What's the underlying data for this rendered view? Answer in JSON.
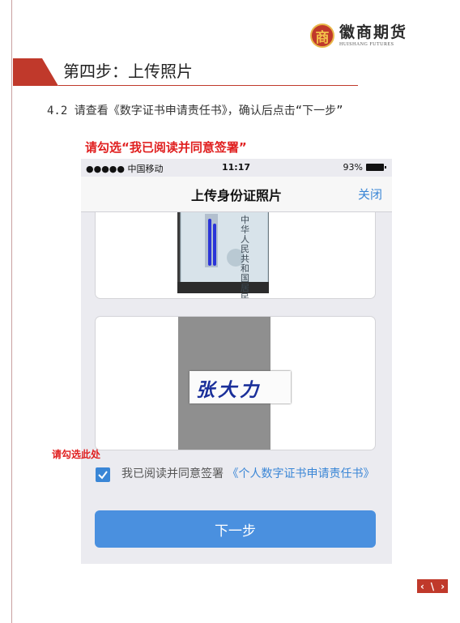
{
  "brand": {
    "emblem_char": "商",
    "name_cn": "徽商期货",
    "name_en": "HUISHANG FUTURES"
  },
  "step": {
    "title": "第四步：上传照片"
  },
  "instruction": {
    "text": "4.2 请查看《数字证书申请责任书》，确认后点击“下一步”"
  },
  "callout": {
    "title": "请勾选“我已阅读并同意签署”",
    "checkbox_hint": "请勾选此处"
  },
  "phone": {
    "status_bar": {
      "signal": "●●●●● 中国移动",
      "time": "11:17",
      "battery": "93%"
    },
    "nav": {
      "title": "上传身份证照片",
      "close_label": "关闭"
    },
    "id_card_text": "中华人民共和国 居民身份证",
    "signature_text": "张大力",
    "agreement": {
      "text": "我已阅读并同意签署",
      "link": "《个人数字证书申请责任书》"
    },
    "next_button": "下一步"
  },
  "pager": {
    "prev": "‹",
    "sep": "\\",
    "next": "›"
  },
  "colors": {
    "accent_red": "#c0392b",
    "ios_blue": "#3a86d6",
    "button_blue": "#4a90df"
  }
}
